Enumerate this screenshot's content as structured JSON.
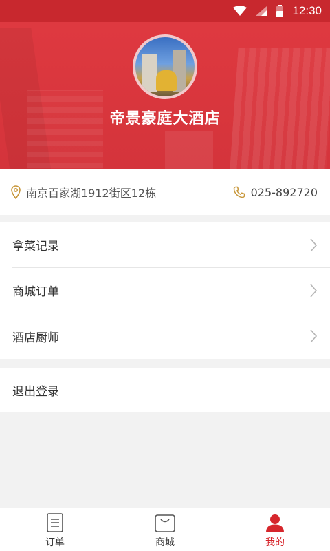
{
  "status_bar": {
    "time": "12:30",
    "icons": [
      "wifi-icon",
      "signal-icon",
      "battery-icon"
    ]
  },
  "header": {
    "hotel_name": "帝景豪庭大酒店",
    "avatar": "hotel-avatar"
  },
  "info": {
    "address": "南京百家湖1912街区12栋",
    "phone": "025-892720",
    "address_icon": "location-pin-icon",
    "phone_icon": "phone-icon"
  },
  "menu": {
    "items": [
      {
        "label": "拿菜记录"
      },
      {
        "label": "商城订单"
      },
      {
        "label": "酒店厨师"
      }
    ],
    "logout": "退出登录"
  },
  "tabbar": {
    "tabs": [
      {
        "label": "订单",
        "icon": "order-list-icon"
      },
      {
        "label": "商城",
        "icon": "shop-bag-icon"
      },
      {
        "label": "我的",
        "icon": "user-icon",
        "active": true
      }
    ]
  },
  "colors": {
    "brand": "#d9363d",
    "active_tab": "#d6262c",
    "accent_icon": "#c8973a"
  }
}
